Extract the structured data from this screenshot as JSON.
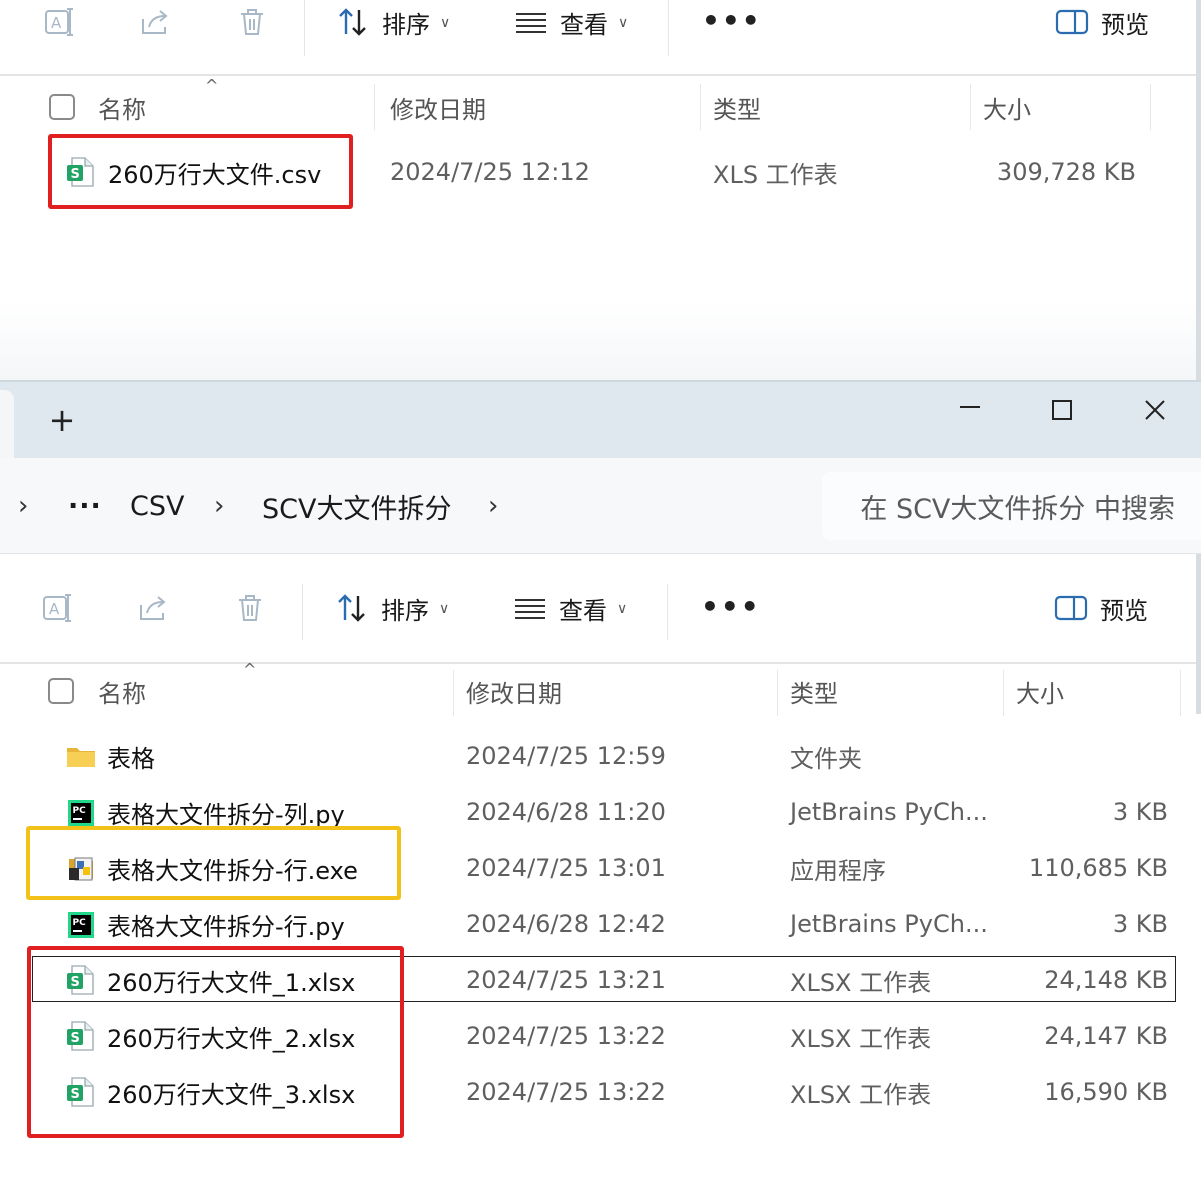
{
  "top_window": {
    "toolbar": {
      "sort_label": "排序",
      "view_label": "查看",
      "more_label": "•••",
      "preview_label": "预览"
    },
    "columns": {
      "name": "名称",
      "modified": "修改日期",
      "type": "类型",
      "size": "大小"
    },
    "files": [
      {
        "name": "260万行大文件.csv",
        "modified": "2024/7/25 12:12",
        "type": "XLS 工作表",
        "size": "309,728 KB",
        "icon": "spreadsheet-icon"
      }
    ]
  },
  "bottom_window": {
    "window_controls": {
      "new_tab": "+",
      "minimize": "—",
      "maximize": "☐",
      "close": "✕"
    },
    "breadcrumb": {
      "more": "···",
      "items": [
        "CSV",
        "SCV大文件拆分"
      ]
    },
    "search": {
      "placeholder": "在 SCV大文件拆分 中搜索"
    },
    "toolbar": {
      "sort_label": "排序",
      "view_label": "查看",
      "more_label": "•••",
      "preview_label": "预览"
    },
    "columns": {
      "name": "名称",
      "modified": "修改日期",
      "type": "类型",
      "size": "大小"
    },
    "files": [
      {
        "name": "表格",
        "modified": "2024/7/25 12:59",
        "type": "文件夹",
        "size": "",
        "icon": "folder-icon"
      },
      {
        "name": "表格大文件拆分-列.py",
        "modified": "2024/6/28 11:20",
        "type": "JetBrains PyCh...",
        "size": "3 KB",
        "icon": "pycharm-icon"
      },
      {
        "name": "表格大文件拆分-行.exe",
        "modified": "2024/7/25 13:01",
        "type": "应用程序",
        "size": "110,685 KB",
        "icon": "python-exe-icon"
      },
      {
        "name": "表格大文件拆分-行.py",
        "modified": "2024/6/28 12:42",
        "type": "JetBrains PyCh...",
        "size": "3 KB",
        "icon": "pycharm-icon"
      },
      {
        "name": "260万行大文件_1.xlsx",
        "modified": "2024/7/25 13:21",
        "type": "XLSX 工作表",
        "size": "24,148 KB",
        "icon": "spreadsheet-icon"
      },
      {
        "name": "260万行大文件_2.xlsx",
        "modified": "2024/7/25 13:22",
        "type": "XLSX 工作表",
        "size": "24,147 KB",
        "icon": "spreadsheet-icon"
      },
      {
        "name": "260万行大文件_3.xlsx",
        "modified": "2024/7/25 13:22",
        "type": "XLSX 工作表",
        "size": "16,590 KB",
        "icon": "spreadsheet-icon"
      }
    ]
  },
  "colors": {
    "highlight_red": "#e02020",
    "highlight_yellow": "#f2c218",
    "spreadsheet_green": "#21a366",
    "folder_yellow": "#f5c542"
  }
}
